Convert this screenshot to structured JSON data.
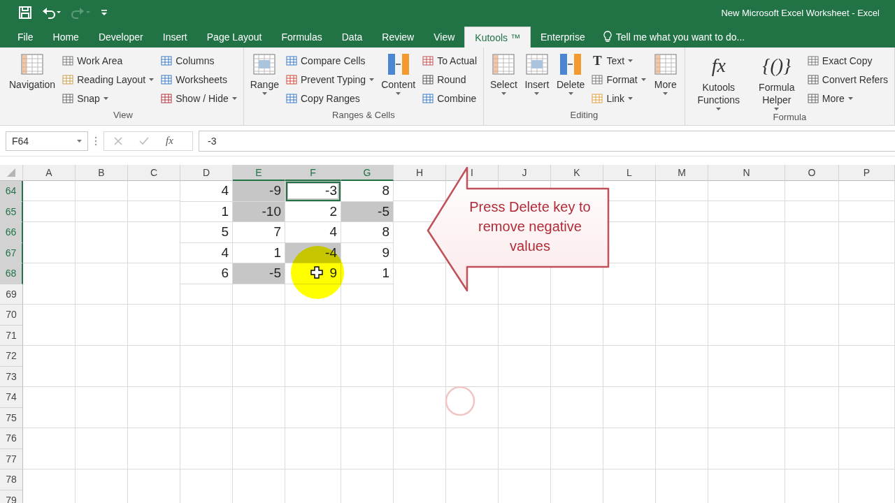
{
  "window": {
    "title": "New Microsoft Excel Worksheet - Excel"
  },
  "quick_access": {
    "redo_disabled": true
  },
  "tabs": [
    {
      "label": "File",
      "selected": false
    },
    {
      "label": "Home",
      "selected": false
    },
    {
      "label": "Developer",
      "selected": false
    },
    {
      "label": "Insert",
      "selected": false
    },
    {
      "label": "Page Layout",
      "selected": false
    },
    {
      "label": "Formulas",
      "selected": false
    },
    {
      "label": "Data",
      "selected": false
    },
    {
      "label": "Review",
      "selected": false
    },
    {
      "label": "View",
      "selected": false
    },
    {
      "label": "Kutools ™",
      "selected": true
    },
    {
      "label": "Enterprise",
      "selected": false
    }
  ],
  "tell_me": {
    "placeholder": "Tell me what you want to do..."
  },
  "ribbon": [
    {
      "label": "View",
      "items": [
        {
          "label": "Navigation",
          "kind": "large",
          "dropdown": false
        },
        {
          "label": "Work Area",
          "kind": "small",
          "dropdown": false
        },
        {
          "label": "Reading Layout",
          "kind": "small",
          "dropdown": true
        },
        {
          "label": "Snap",
          "kind": "small",
          "dropdown": true
        },
        {
          "label": "Columns",
          "kind": "small",
          "dropdown": false
        },
        {
          "label": "Worksheets",
          "kind": "small",
          "dropdown": false
        },
        {
          "label": "Show / Hide",
          "kind": "small",
          "dropdown": true
        }
      ]
    },
    {
      "label": "Ranges & Cells",
      "items": [
        {
          "label": "Range",
          "kind": "large",
          "dropdown": true
        },
        {
          "label": "Compare Cells",
          "kind": "small",
          "dropdown": false
        },
        {
          "label": "Prevent Typing",
          "kind": "small",
          "dropdown": true
        },
        {
          "label": "Copy Ranges",
          "kind": "small",
          "dropdown": false
        },
        {
          "label": "Content",
          "kind": "large",
          "dropdown": true
        },
        {
          "label": "To Actual",
          "kind": "small",
          "dropdown": false
        },
        {
          "label": "Round",
          "kind": "small",
          "dropdown": false
        },
        {
          "label": "Combine",
          "kind": "small",
          "dropdown": false
        }
      ]
    },
    {
      "label": "Editing",
      "items": [
        {
          "label": "Select",
          "kind": "large",
          "dropdown": true
        },
        {
          "label": "Insert",
          "kind": "large",
          "dropdown": true
        },
        {
          "label": "Delete",
          "kind": "large",
          "dropdown": true
        },
        {
          "label": "Text",
          "kind": "small",
          "dropdown": true,
          "glyph": "T"
        },
        {
          "label": "Format",
          "kind": "small",
          "dropdown": true
        },
        {
          "label": "Link",
          "kind": "small",
          "dropdown": true
        },
        {
          "label": "More",
          "kind": "large",
          "dropdown": true
        }
      ]
    },
    {
      "label": "Formula",
      "items": [
        {
          "label": "Kutools Functions",
          "kind": "large",
          "dropdown": true,
          "glyph": "fx"
        },
        {
          "label": "Formula Helper",
          "kind": "large",
          "dropdown": true,
          "glyph": "{()}"
        },
        {
          "label": "Exact Copy",
          "kind": "small",
          "dropdown": false
        },
        {
          "label": "Convert Refers",
          "kind": "small",
          "dropdown": false
        },
        {
          "label": "More",
          "kind": "small",
          "dropdown": true
        }
      ]
    }
  ],
  "formula_bar": {
    "name_box": "F64",
    "fx_label": "fx",
    "formula": "-3"
  },
  "sheet": {
    "columns": [
      {
        "label": "A",
        "selected": false
      },
      {
        "label": "B",
        "selected": false
      },
      {
        "label": "C",
        "selected": false
      },
      {
        "label": "D",
        "selected": false
      },
      {
        "label": "E",
        "selected": true
      },
      {
        "label": "F",
        "selected": true
      },
      {
        "label": "G",
        "selected": true
      },
      {
        "label": "H",
        "selected": false
      },
      {
        "label": "I",
        "selected": false
      },
      {
        "label": "J",
        "selected": false
      },
      {
        "label": "K",
        "selected": false
      },
      {
        "label": "L",
        "selected": false
      },
      {
        "label": "M",
        "selected": false
      },
      {
        "label": "N",
        "selected": false
      },
      {
        "label": "O",
        "selected": false
      },
      {
        "label": "P",
        "selected": false
      }
    ],
    "rows": [
      {
        "label": "64",
        "selected": true,
        "cells": [
          {
            "value": "4",
            "selected": false,
            "active": false
          },
          {
            "value": "-9",
            "selected": true,
            "active": false
          },
          {
            "value": "-3",
            "selected": true,
            "active": true
          },
          {
            "value": "8",
            "selected": false,
            "active": false
          }
        ]
      },
      {
        "label": "65",
        "selected": true,
        "cells": [
          {
            "value": "1",
            "selected": false,
            "active": false
          },
          {
            "value": "-10",
            "selected": true,
            "active": false
          },
          {
            "value": "2",
            "selected": false,
            "active": false
          },
          {
            "value": "-5",
            "selected": true,
            "active": false
          }
        ]
      },
      {
        "label": "66",
        "selected": true,
        "cells": [
          {
            "value": "5",
            "selected": false,
            "active": false
          },
          {
            "value": "7",
            "selected": false,
            "active": false
          },
          {
            "value": "4",
            "selected": false,
            "active": false
          },
          {
            "value": "8",
            "selected": false,
            "active": false
          }
        ]
      },
      {
        "label": "67",
        "selected": true,
        "cells": [
          {
            "value": "4",
            "selected": false,
            "active": false
          },
          {
            "value": "1",
            "selected": false,
            "active": false
          },
          {
            "value": "-4",
            "selected": true,
            "active": false
          },
          {
            "value": "9",
            "selected": false,
            "active": false
          }
        ]
      },
      {
        "label": "68",
        "selected": true,
        "cells": [
          {
            "value": "6",
            "selected": false,
            "active": false
          },
          {
            "value": "-5",
            "selected": true,
            "active": false
          },
          {
            "value": "9",
            "selected": false,
            "active": false
          },
          {
            "value": "1",
            "selected": false,
            "active": false
          }
        ]
      },
      {
        "label": "69",
        "selected": false
      },
      {
        "label": "70",
        "selected": false
      },
      {
        "label": "71",
        "selected": false
      },
      {
        "label": "72",
        "selected": false
      },
      {
        "label": "73",
        "selected": false
      },
      {
        "label": "74",
        "selected": false
      },
      {
        "label": "75",
        "selected": false
      },
      {
        "label": "76",
        "selected": false
      },
      {
        "label": "77",
        "selected": false
      },
      {
        "label": "78",
        "selected": false
      },
      {
        "label": "79",
        "selected": false
      }
    ]
  },
  "callout": {
    "text": "Press Delete key to remove negative values"
  }
}
